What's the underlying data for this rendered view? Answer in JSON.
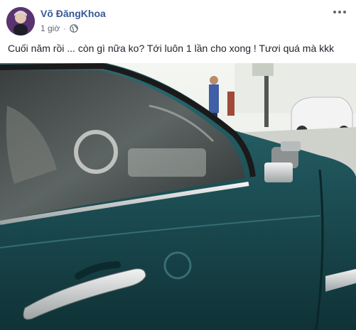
{
  "post": {
    "author": "Võ ĐăngKhoa",
    "time": "1 giờ",
    "separator": "·",
    "privacy_icon": "globe-icon",
    "more_icon": "ellipsis-icon",
    "text": "Cuối năm rồi ... còn gì nữa ko? Tới luôn 1 lần cho xong ! Tươi quá mà kkk"
  },
  "colors": {
    "author_link": "#385898",
    "car_paint": "#1d4c50",
    "meta_text": "#616770"
  }
}
